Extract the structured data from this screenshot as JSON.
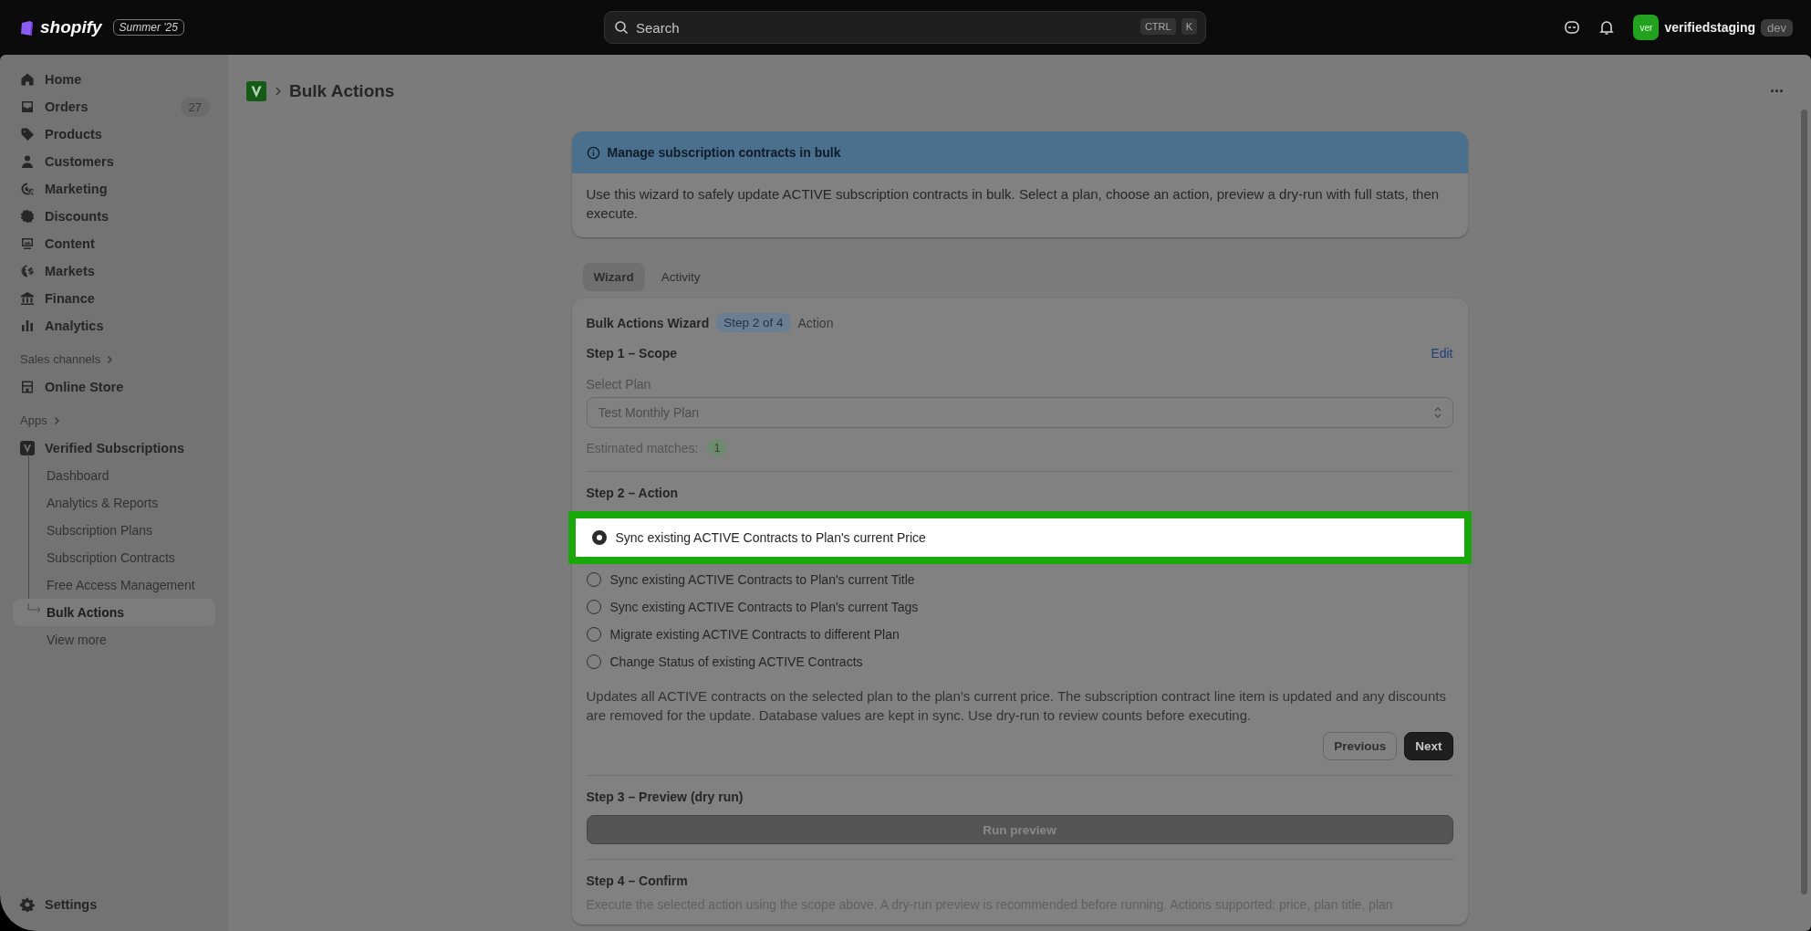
{
  "topbar": {
    "logo": "shopify",
    "edition": "Summer '25",
    "search": {
      "placeholder": "Search",
      "keys": [
        "CTRL",
        "K"
      ]
    },
    "store": {
      "avatar": "ver",
      "name": "verifiedstaging",
      "badge": "dev"
    }
  },
  "sidebar": {
    "items": [
      {
        "label": "Home"
      },
      {
        "label": "Orders",
        "count": "27"
      },
      {
        "label": "Products"
      },
      {
        "label": "Customers"
      },
      {
        "label": "Marketing"
      },
      {
        "label": "Discounts"
      },
      {
        "label": "Content"
      },
      {
        "label": "Markets"
      },
      {
        "label": "Finance"
      },
      {
        "label": "Analytics"
      }
    ],
    "sales_channels": {
      "label": "Sales channels",
      "items": [
        {
          "label": "Online Store"
        }
      ]
    },
    "apps": {
      "label": "Apps",
      "app": {
        "label": "Verified Subscriptions",
        "children": [
          {
            "label": "Dashboard",
            "selected": false
          },
          {
            "label": "Analytics & Reports",
            "selected": false
          },
          {
            "label": "Subscription Plans",
            "selected": false
          },
          {
            "label": "Subscription Contracts",
            "selected": false
          },
          {
            "label": "Free Access Management",
            "selected": false
          },
          {
            "label": "Bulk Actions",
            "selected": true
          },
          {
            "label": "View more",
            "selected": false
          }
        ]
      }
    },
    "settings": "Settings"
  },
  "page": {
    "title": "Bulk Actions",
    "more": "···"
  },
  "banner": {
    "title": "Manage subscription contracts in bulk",
    "body": "Use this wizard to safely update ACTIVE subscription contracts in bulk. Select a plan, choose an action, preview a dry-run with full stats, then execute."
  },
  "tabs": [
    {
      "label": "Wizard",
      "selected": true
    },
    {
      "label": "Activity",
      "selected": false
    }
  ],
  "wizard": {
    "title": "Bulk Actions Wizard",
    "step_badge": "Step 2 of 4",
    "step_name": "Action",
    "step1": {
      "title": "Step 1 – Scope",
      "edit": "Edit",
      "plan_label": "Select Plan",
      "plan_value": "Test Monthly Plan",
      "matches_label": "Estimated matches:",
      "matches": "1"
    },
    "step2": {
      "title": "Step 2 – Action",
      "options": [
        {
          "label": "Sync existing ACTIVE Contracts to Plan's current Price",
          "selected": true,
          "highlighted": true
        },
        {
          "label": "Sync existing ACTIVE Contracts to Plan's current Title",
          "selected": false,
          "highlighted": false
        },
        {
          "label": "Sync existing ACTIVE Contracts to Plan's current Tags",
          "selected": false,
          "highlighted": false
        },
        {
          "label": "Migrate existing ACTIVE Contracts to different Plan",
          "selected": false,
          "highlighted": false
        },
        {
          "label": "Change Status of existing ACTIVE Contracts",
          "selected": false,
          "highlighted": false
        }
      ],
      "description": "Updates all ACTIVE contracts on the selected plan to the plan’s current price. The subscription contract line item is updated and any discounts are removed for the update. Database values are kept in sync. Use dry-run to review counts before executing.",
      "previous": "Previous",
      "next": "Next"
    },
    "step3": {
      "title": "Step 3 – Preview (dry run)",
      "button": "Run preview",
      "disabled": true
    },
    "step4": {
      "title": "Step 4 – Confirm",
      "body": "Execute the selected action using the scope above. A dry-run preview is recommended before running. Actions supported: price, plan title, plan"
    }
  }
}
